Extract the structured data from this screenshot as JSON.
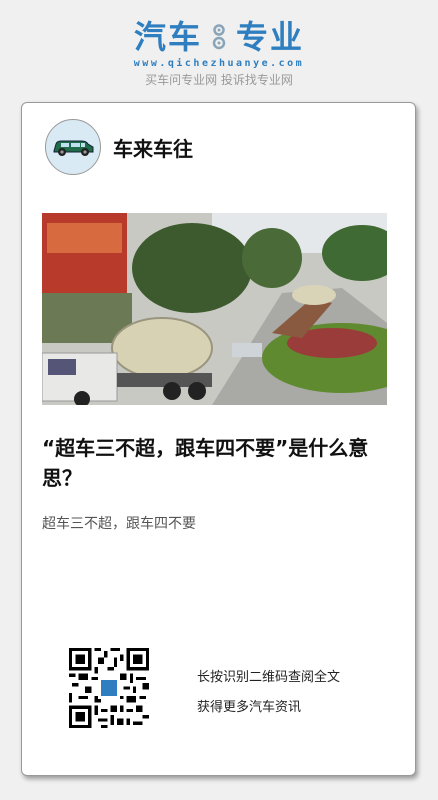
{
  "brand": {
    "title_left": "汽车",
    "title_right": "专业",
    "url": "www.qichezhuanye.com",
    "slogan": "买车问专业网 投诉找专业网",
    "color": "#2f7fc0"
  },
  "author": {
    "name": "车来车往",
    "avatar_icon": "car-icon"
  },
  "article": {
    "headline": "“超车三不超，跟车四不要”是什么意思？",
    "summary": "超车三不超，跟车四不要",
    "image_icon": "photo-road-traffic"
  },
  "qr": {
    "line1": "长按识别二维码查阅全文",
    "line2": "获得更多汽车资讯"
  }
}
